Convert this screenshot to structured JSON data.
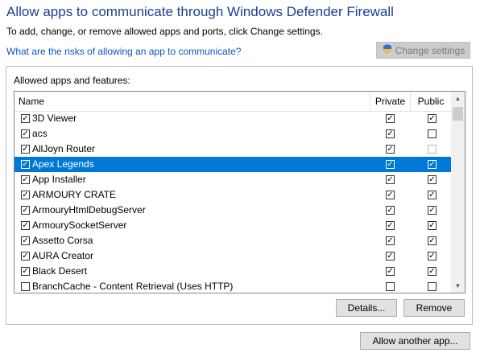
{
  "header": {
    "title": "Allow apps to communicate through Windows Defender Firewall",
    "subtitle": "To add, change, or remove allowed apps and ports, click Change settings.",
    "risk_link": "What are the risks of allowing an app to communicate?",
    "change_settings_label": "Change settings"
  },
  "list": {
    "group_label": "Allowed apps and features:",
    "columns": {
      "name": "Name",
      "private": "Private",
      "public": "Public"
    },
    "rows": [
      {
        "name": "3D Viewer",
        "enabled": true,
        "private": true,
        "public": true,
        "selected": false,
        "public_dim": false
      },
      {
        "name": "acs",
        "enabled": true,
        "private": true,
        "public": false,
        "selected": false,
        "public_dim": false
      },
      {
        "name": "AllJoyn Router",
        "enabled": true,
        "private": true,
        "public": false,
        "selected": false,
        "public_dim": true
      },
      {
        "name": "Apex Legends",
        "enabled": true,
        "private": true,
        "public": true,
        "selected": true,
        "public_dim": false
      },
      {
        "name": "App Installer",
        "enabled": true,
        "private": true,
        "public": true,
        "selected": false,
        "public_dim": false
      },
      {
        "name": "ARMOURY CRATE",
        "enabled": true,
        "private": true,
        "public": true,
        "selected": false,
        "public_dim": false
      },
      {
        "name": "ArmouryHtmlDebugServer",
        "enabled": true,
        "private": true,
        "public": true,
        "selected": false,
        "public_dim": false
      },
      {
        "name": "ArmourySocketServer",
        "enabled": true,
        "private": true,
        "public": true,
        "selected": false,
        "public_dim": false
      },
      {
        "name": "Assetto Corsa",
        "enabled": true,
        "private": true,
        "public": true,
        "selected": false,
        "public_dim": false
      },
      {
        "name": "AURA Creator",
        "enabled": true,
        "private": true,
        "public": true,
        "selected": false,
        "public_dim": false
      },
      {
        "name": "Black Desert",
        "enabled": true,
        "private": true,
        "public": true,
        "selected": false,
        "public_dim": false
      },
      {
        "name": "BranchCache - Content Retrieval (Uses HTTP)",
        "enabled": false,
        "private": false,
        "public": false,
        "selected": false,
        "public_dim": false
      }
    ]
  },
  "buttons": {
    "details": "Details...",
    "remove": "Remove",
    "allow_another": "Allow another app..."
  },
  "colors": {
    "title": "#1b3f91",
    "link": "#0b55c4",
    "selection": "#0078d7"
  },
  "icons": {
    "change_settings": "uac-shield-icon"
  }
}
